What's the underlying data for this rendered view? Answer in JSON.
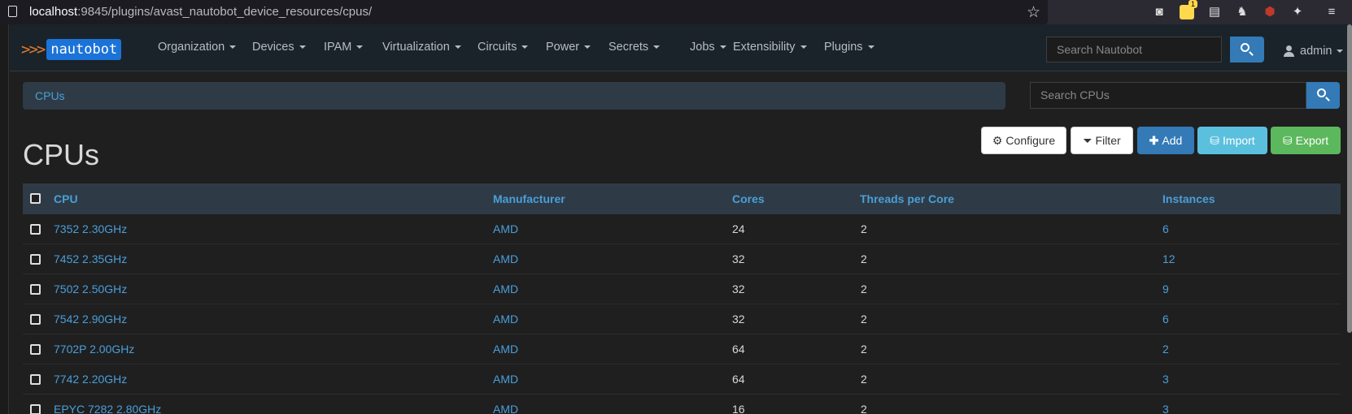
{
  "browser": {
    "url_host": "localhost",
    "url_path": ":9845/plugins/avast_nautobot_device_resources/cpus/",
    "ext_badge": "1"
  },
  "navbar": {
    "brand": "nautobot",
    "brand_chevrons": ">>>",
    "items": [
      "Organization",
      "Devices",
      "IPAM",
      "Virtualization",
      "Circuits",
      "Power",
      "Secrets",
      "Jobs",
      "Extensibility",
      "Plugins"
    ],
    "search_placeholder": "Search Nautobot",
    "user": "admin"
  },
  "breadcrumb": {
    "current": "CPUs"
  },
  "list_search_placeholder": "Search CPUs",
  "page_title": "CPUs",
  "buttons": {
    "configure": "Configure",
    "filter": "Filter",
    "add": "Add",
    "import": "Import",
    "export": "Export"
  },
  "table": {
    "columns": [
      "CPU",
      "Manufacturer",
      "Cores",
      "Threads per Core",
      "Instances"
    ],
    "rows": [
      {
        "cpu": "7352 2.30GHz",
        "manufacturer": "AMD",
        "cores": "24",
        "threads": "2",
        "instances": "6"
      },
      {
        "cpu": "7452 2.35GHz",
        "manufacturer": "AMD",
        "cores": "32",
        "threads": "2",
        "instances": "12"
      },
      {
        "cpu": "7502 2.50GHz",
        "manufacturer": "AMD",
        "cores": "32",
        "threads": "2",
        "instances": "9"
      },
      {
        "cpu": "7542 2.90GHz",
        "manufacturer": "AMD",
        "cores": "32",
        "threads": "2",
        "instances": "6"
      },
      {
        "cpu": "7702P 2.00GHz",
        "manufacturer": "AMD",
        "cores": "64",
        "threads": "2",
        "instances": "2"
      },
      {
        "cpu": "7742 2.20GHz",
        "manufacturer": "AMD",
        "cores": "64",
        "threads": "2",
        "instances": "3"
      },
      {
        "cpu": "EPYC 7282 2.80GHz",
        "manufacturer": "AMD",
        "cores": "16",
        "threads": "2",
        "instances": "3"
      }
    ]
  },
  "colors": {
    "accent": "#337ab7",
    "link": "#4a9fd8",
    "info": "#5bc0de",
    "success": "#5cb85c",
    "navbar_bg": "#1a2329"
  }
}
